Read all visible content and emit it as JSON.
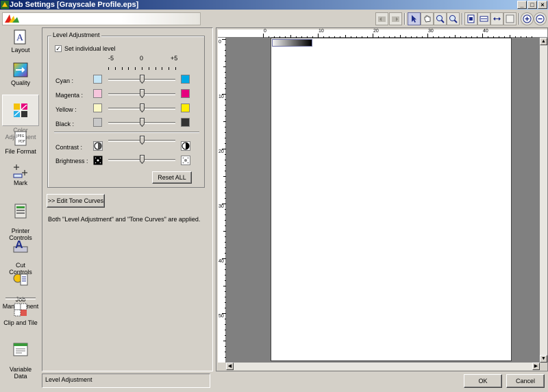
{
  "window": {
    "title": "Job Settings [Grayscale Profile.eps]",
    "min_glyph": "_",
    "max_glyph": "□",
    "close_glyph": "×"
  },
  "toolbar": {
    "buttons": [
      "undo",
      "redo",
      "select-arrow",
      "hand",
      "zoom-in-glass",
      "zoom-out-glass",
      "fit-page",
      "fit-width",
      "fit-fill",
      "actual-size",
      "zoom-plus",
      "zoom-minus"
    ],
    "selected": "select-arrow"
  },
  "sidebar": {
    "items": [
      {
        "label": "Layout",
        "icon": "layout-icon"
      },
      {
        "label": "Quality",
        "icon": "quality-icon"
      },
      {
        "label": "Color\nAdjustment",
        "icon": "color-adjustment-icon",
        "active": true
      },
      {
        "label": "File Format",
        "icon": "file-format-icon"
      },
      {
        "label": "Mark",
        "icon": "mark-icon"
      },
      {
        "label": "Printer\nControls",
        "icon": "printer-controls-icon"
      },
      {
        "label": "Cut\nControls",
        "icon": "cut-controls-icon"
      },
      {
        "label": "Job\nManagement",
        "icon": "job-management-icon"
      },
      {
        "label": "Clip and Tile",
        "icon": "clip-and-tile-icon"
      },
      {
        "label": "Variable\nData",
        "icon": "variable-data-icon"
      }
    ]
  },
  "level_adjustment": {
    "group_title": "Level Adjustment",
    "checkbox_label": "Set individual level",
    "checkbox_checked": true,
    "scale_min": "-5",
    "scale_mid": "0",
    "scale_max": "+5",
    "rows": [
      {
        "label": "Cyan :",
        "left_color": "#c6e6f6",
        "right_color": "#00a9e6",
        "value": 0
      },
      {
        "label": "Magenta :",
        "left_color": "#f6c6dc",
        "right_color": "#e6007e",
        "value": 0
      },
      {
        "label": "Yellow :",
        "left_color": "#fbf8c6",
        "right_color": "#ffee00",
        "value": 0
      },
      {
        "label": "Black :",
        "left_color": "#c8c8c8",
        "right_color": "#333333",
        "value": 0
      }
    ],
    "contrast_label": "Contrast :",
    "contrast_value": 0,
    "brightness_label": "Brightness :",
    "brightness_value": 0,
    "reset_label": "Reset ALL"
  },
  "tone_curves_button": ">> Edit Tone Curves",
  "note": "Both \"Level Adjustment\" and \"Tone Curves\" are applied.",
  "status_text": "Level Adjustment",
  "ruler": {
    "top_labels": [
      "0",
      "10",
      "20",
      "30",
      "40"
    ],
    "left_labels": [
      "0",
      "10",
      "20",
      "30",
      "40",
      "50"
    ]
  },
  "ok_label": "OK",
  "cancel_label": "Cancel"
}
